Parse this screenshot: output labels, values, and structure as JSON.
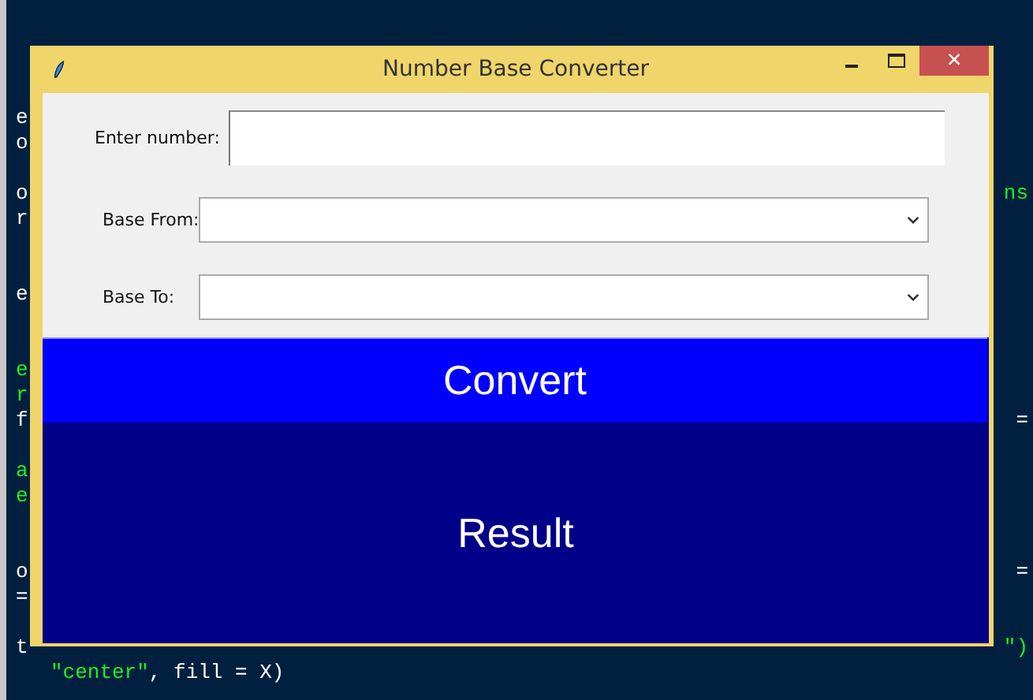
{
  "editor": {
    "lines": [
      {
        "left": {
          "text": "e",
          "kind": "code"
        }
      },
      {
        "left": {
          "text": "o",
          "kind": "code"
        }
      },
      {
        "kind": "blank"
      },
      {
        "left": {
          "text": "o",
          "kind": "code"
        },
        "right": {
          "text": "ns",
          "kind": "string"
        }
      },
      {
        "left": {
          "text": "r",
          "kind": "code"
        }
      },
      {
        "kind": "blank"
      },
      {
        "kind": "blank"
      },
      {
        "left": {
          "text": "e",
          "kind": "code"
        }
      },
      {
        "kind": "blank"
      },
      {
        "kind": "blank"
      },
      {
        "left": {
          "text": "e",
          "kind": "string"
        }
      },
      {
        "left": {
          "text": "r",
          "kind": "string"
        }
      },
      {
        "left": {
          "text": "f",
          "kind": "code"
        },
        "right": {
          "text": "=",
          "kind": "code"
        }
      },
      {
        "kind": "blank"
      },
      {
        "left": {
          "text": "a",
          "kind": "string"
        }
      },
      {
        "left": {
          "text": "e",
          "kind": "string"
        }
      },
      {
        "kind": "blank"
      },
      {
        "kind": "blank"
      },
      {
        "left": {
          "text": "o",
          "kind": "code"
        },
        "right": {
          "text": "=",
          "kind": "code"
        }
      },
      {
        "left": {
          "text": "=",
          "kind": "code"
        }
      },
      {
        "kind": "blank"
      },
      {
        "left": {
          "text": "t",
          "kind": "code"
        },
        "right": {
          "text": "\")",
          "kind": "string"
        }
      },
      {
        "full": [
          {
            "text": "\"center\"",
            "kind": "string"
          },
          {
            "text": ", fill = X)",
            "kind": "code"
          }
        ]
      }
    ]
  },
  "window": {
    "title": "Number Base Converter",
    "close_label": "×",
    "form": [
      {
        "kind": "entry",
        "label": "Enter number:"
      },
      {
        "kind": "combo",
        "label": "Base From:"
      },
      {
        "kind": "combo",
        "label": "Base To:"
      }
    ],
    "convert_button": "Convert",
    "result": "Result"
  }
}
